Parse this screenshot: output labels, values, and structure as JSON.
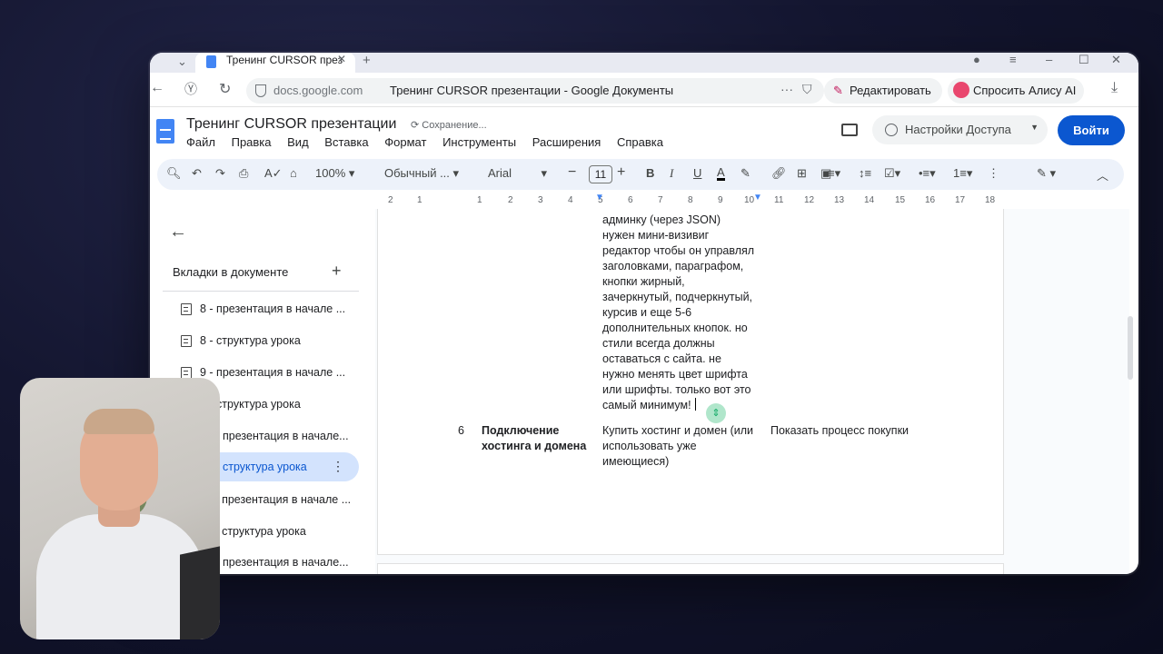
{
  "browser": {
    "tab_title": "Тренинг CURSOR през",
    "url_domain": "docs.google.com",
    "page_title": "Тренинг CURSOR презентации - Google Документы",
    "edit_label": "Редактировать",
    "alice_label": "Спросить Алису AI"
  },
  "doc": {
    "title": "Тренинг CURSOR презентации",
    "status": "Сохранение...",
    "menu": [
      "Файл",
      "Правка",
      "Вид",
      "Вставка",
      "Формат",
      "Инструменты",
      "Расширения",
      "Справка"
    ],
    "access_label": "Настройки Доступа",
    "login_label": "Войти"
  },
  "toolbar": {
    "zoom": "100%",
    "style": "Обычный ...",
    "font": "Arial",
    "font_size": "11"
  },
  "ruler": [
    "2",
    "1",
    "1",
    "2",
    "3",
    "4",
    "5",
    "6",
    "7",
    "8",
    "9",
    "10",
    "11",
    "12",
    "13",
    "14",
    "15",
    "16",
    "17",
    "18"
  ],
  "sidebar": {
    "heading": "Вкладки в документе",
    "items": [
      {
        "label": "8 - презентация в начале ..."
      },
      {
        "label": "8 - структура урока"
      },
      {
        "label": "9 - презентация в начале ..."
      },
      {
        "label": "9 - структура урока"
      },
      {
        "label": "10 - презентация в начале..."
      },
      {
        "label": "10 - структура урока"
      },
      {
        "label": "11 - презентация в начале ..."
      },
      {
        "label": "11 - структура урока"
      },
      {
        "label": "12 - презентация в начале..."
      }
    ]
  },
  "document": {
    "cell_top_lines": [
      "админку (через JSON)",
      "нужен мини-визивиг",
      "редактор чтобы он управлял",
      "заголовками, параграфом,",
      "кнопки жирный,",
      "зачеркнутый, подчеркнутый,",
      "курсив и еще 5-6",
      "дополнительных кнопок. но",
      "стили всегда должны",
      "оставаться с сайта. не",
      "нужно менять цвет шрифта",
      "или шрифты. только вот это",
      "самый минимум!"
    ],
    "row6": {
      "number": "6",
      "title_line1": "Подключение",
      "title_line2": "хостинга и домена",
      "task_line1": "Купить хостинг и домен (или",
      "task_line2": "использовать уже",
      "task_line3": "имеющиеся)",
      "note": "Показать процесс покупки"
    }
  }
}
